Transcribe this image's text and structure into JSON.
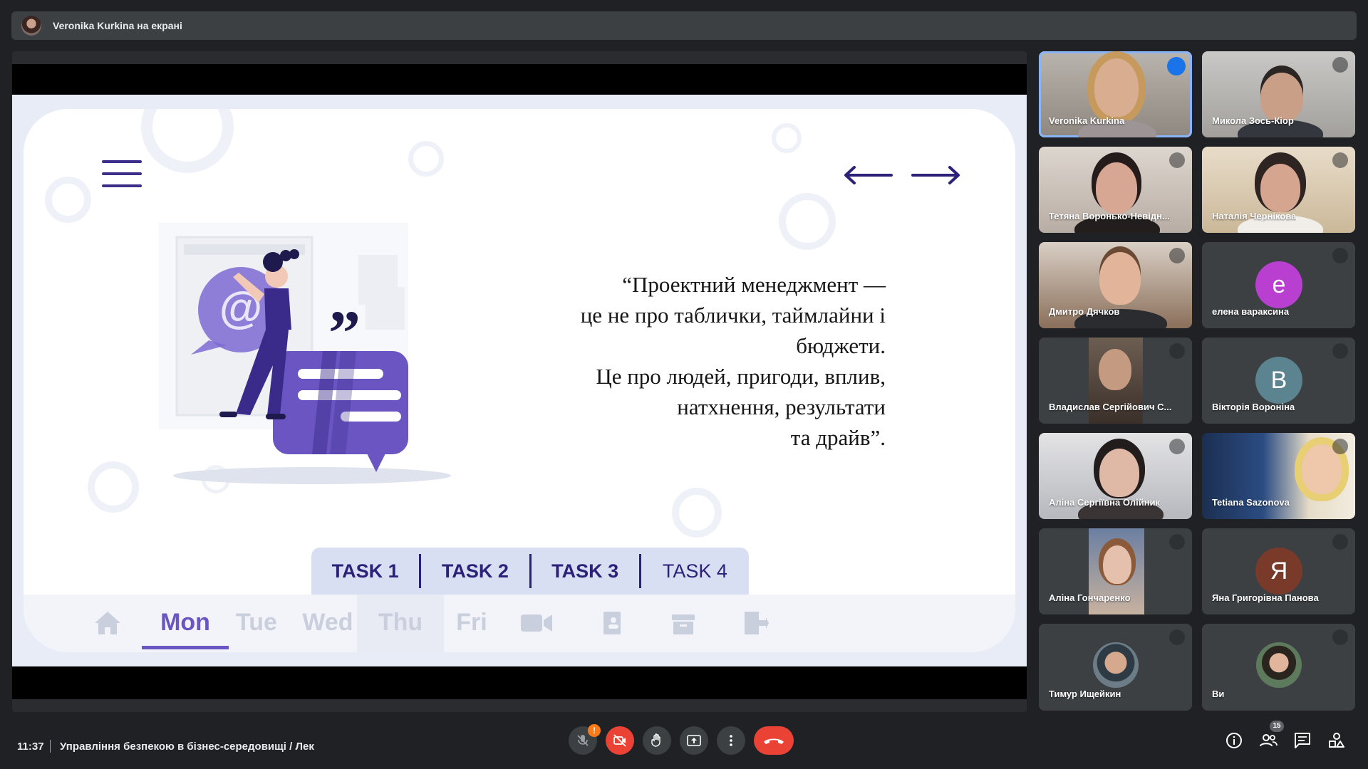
{
  "presenter_bar": {
    "text": "Veronika Kurkina на екрані"
  },
  "slide": {
    "quote_lines": [
      "“Проектний менеджмент —",
      "це не про таблички,  таймлайни і",
      "бюджети.",
      "Це про людей, пригоди, вплив,",
      "натхнення, результати",
      "та драйв”."
    ],
    "tasks": [
      "TASK 1",
      "TASK 2",
      "TASK 3",
      "TASK 4"
    ],
    "days": [
      "Mon",
      "Tue",
      "Wed",
      "Thu",
      "Fri"
    ],
    "active_day": "Mon",
    "accent_color": "#6a55c2",
    "dark_color": "#2c2178"
  },
  "participants": [
    {
      "name": "Veronika Kurkina",
      "speaking": true,
      "avatar": "photo"
    },
    {
      "name": "Микола Зось-Кіор",
      "muted": true,
      "avatar": "photo"
    },
    {
      "name": "Тетяна Воронько-Невідн...",
      "muted": true,
      "avatar": "photo"
    },
    {
      "name": "Наталія Чернікова",
      "muted": true,
      "avatar": "photo"
    },
    {
      "name": "Дмитро Дячков",
      "muted": true,
      "avatar": "photo"
    },
    {
      "name": "елена вараксина",
      "muted": true,
      "avatar_letter": "е",
      "avatar_color": "#b93fd1"
    },
    {
      "name": "Владислав Сергійович С...",
      "muted": true,
      "avatar": "photo"
    },
    {
      "name": "Вікторія Вороніна",
      "muted": true,
      "avatar_letter": "B",
      "avatar_color": "#5b8390"
    },
    {
      "name": "Аліна Сергіївна Олійник",
      "muted": true,
      "avatar": "photo"
    },
    {
      "name": "Tetiana Sazonova",
      "muted": true,
      "avatar": "photo"
    },
    {
      "name": "Аліна Гончаренко",
      "muted": true,
      "avatar": "photo"
    },
    {
      "name": "Яна Григорівна Панова",
      "muted": true,
      "avatar_letter": "Я",
      "avatar_color": "#7a3a2a"
    },
    {
      "name": "Тимур Ищейкин",
      "muted": true,
      "avatar": "photo-circle"
    },
    {
      "name": "Ви",
      "muted": true,
      "avatar": "photo-circle"
    }
  ],
  "bottom_bar": {
    "time": "11:37",
    "meeting_title": "Управління безпекою в бізнес-середовищі / Лек",
    "mic_warning": "!",
    "participants_count": "15",
    "icons": [
      "mic-off-icon",
      "camera-off-icon",
      "raise-hand-icon",
      "present-icon",
      "more-options-icon",
      "end-call-icon",
      "info-icon",
      "people-icon",
      "chat-icon",
      "activities-icon"
    ]
  }
}
